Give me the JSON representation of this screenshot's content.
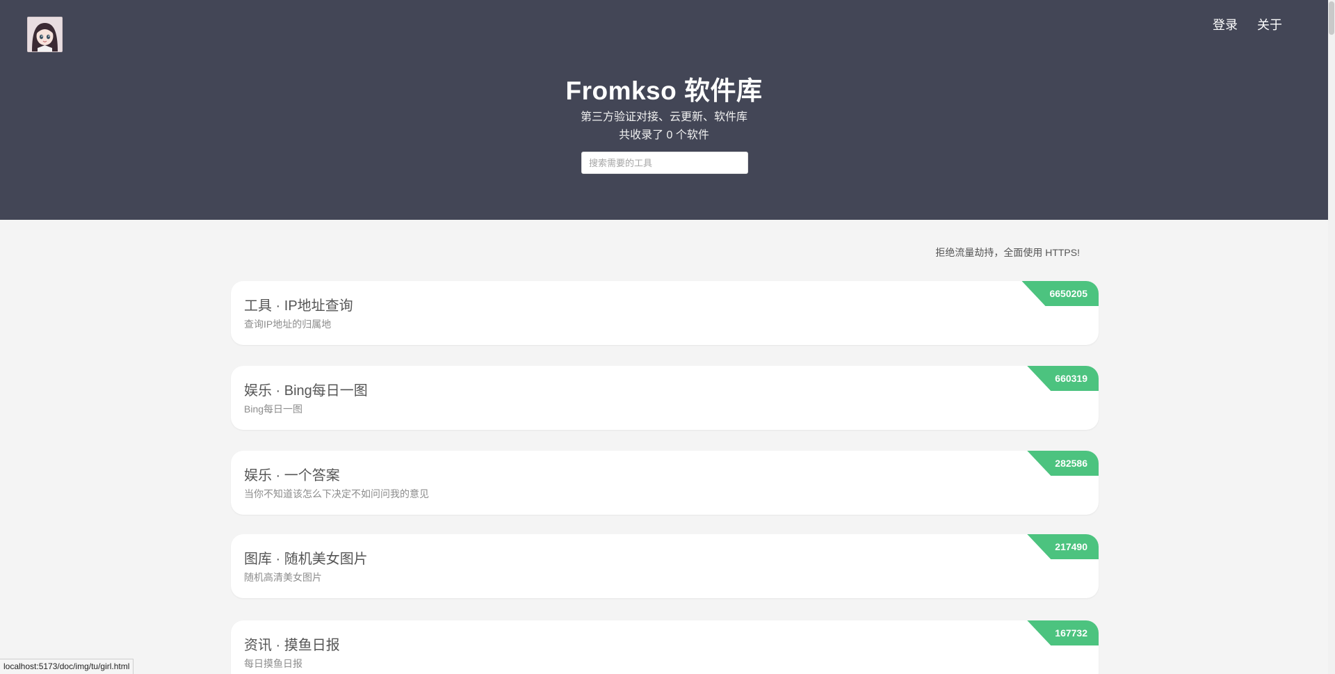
{
  "header": {
    "nav": {
      "login": "登录",
      "about": "关于"
    },
    "title": "Fromkso 软件库",
    "subtitle": "第三方验证对接、云更新、软件库",
    "count_text": "共收录了 0 个软件",
    "search": {
      "placeholder": "搜索需要的工具",
      "value": ""
    }
  },
  "notice": "拒绝流量劫持，全面使用 HTTPS!",
  "cards": [
    {
      "title": "工具 · IP地址查询",
      "desc": "查询IP地址的归属地",
      "count": "6650205"
    },
    {
      "title": "娱乐 · Bing每日一图",
      "desc": "Bing每日一图",
      "count": "660319"
    },
    {
      "title": "娱乐 · 一个答案",
      "desc": "当你不知道该怎么下决定不如问问我的意见",
      "count": "282586"
    },
    {
      "title": "图库 · 随机美女图片",
      "desc": "随机高清美女图片",
      "count": "217490"
    },
    {
      "title": "资讯 · 摸鱼日报",
      "desc": "每日摸鱼日报",
      "count": "167732"
    }
  ],
  "status_bar": {
    "url": "localhost:5173/doc/img/tu/girl.html"
  },
  "colors": {
    "header_bg": "#434656",
    "badge": "#4cc37f",
    "page_bg": "#f4f4f4"
  },
  "icons": {
    "avatar": "anime-girl-avatar"
  }
}
